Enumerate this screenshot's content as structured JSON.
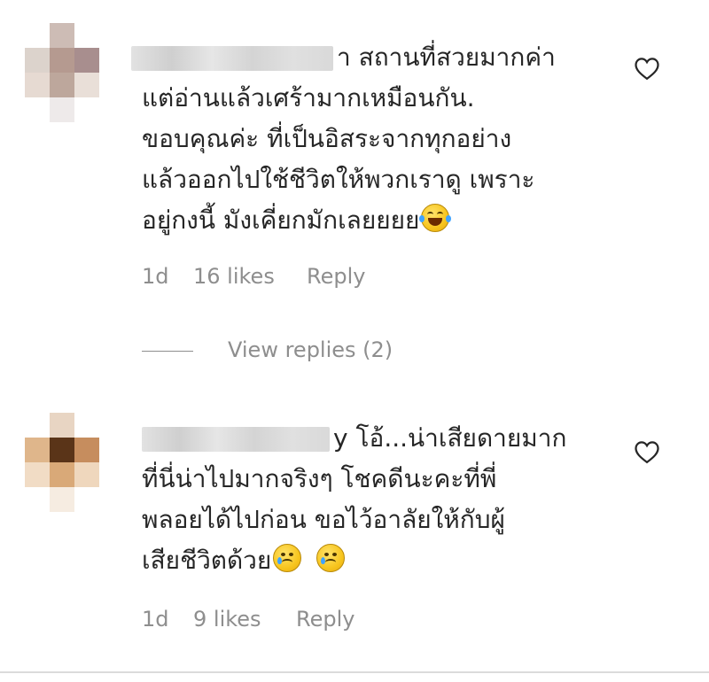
{
  "comments": [
    {
      "lines": [
        "า สถานที่สวยมากค่า",
        "แต่อ่านแล้วเศร้ามากเหมือนกัน.",
        "ขอบคุณค่ะ ที่เป็นอิสระจากทุกอย่าง",
        "แล้วออกไปใช้ชีวิตให้พวกเราดู เพราะ",
        "อยู่กงนี้ มังเคี่ยกมักเลยยยย"
      ],
      "emoji": "face-with-tears-of-joy",
      "time": "1d",
      "likes": "16 likes",
      "reply": "Reply",
      "view_replies": "View replies (2)"
    },
    {
      "lines": [
        "y โอ้...น่าเสียดายมาก",
        "ที่นี่น่าไปมากจริงๆ โชคดีนะคะที่พี่",
        "พลอยได้ไปก่อน ขอไว้อาลัยให้กับผู้",
        "เสียชีวิตด้วย"
      ],
      "emoji": "crying-face",
      "time": "1d",
      "likes": "9 likes",
      "reply": "Reply"
    }
  ],
  "colors": {
    "text": "#262626",
    "secondary": "#8e8e8e",
    "divider": "#dbdbdb"
  },
  "icons": [
    "heart-outline-icon"
  ]
}
